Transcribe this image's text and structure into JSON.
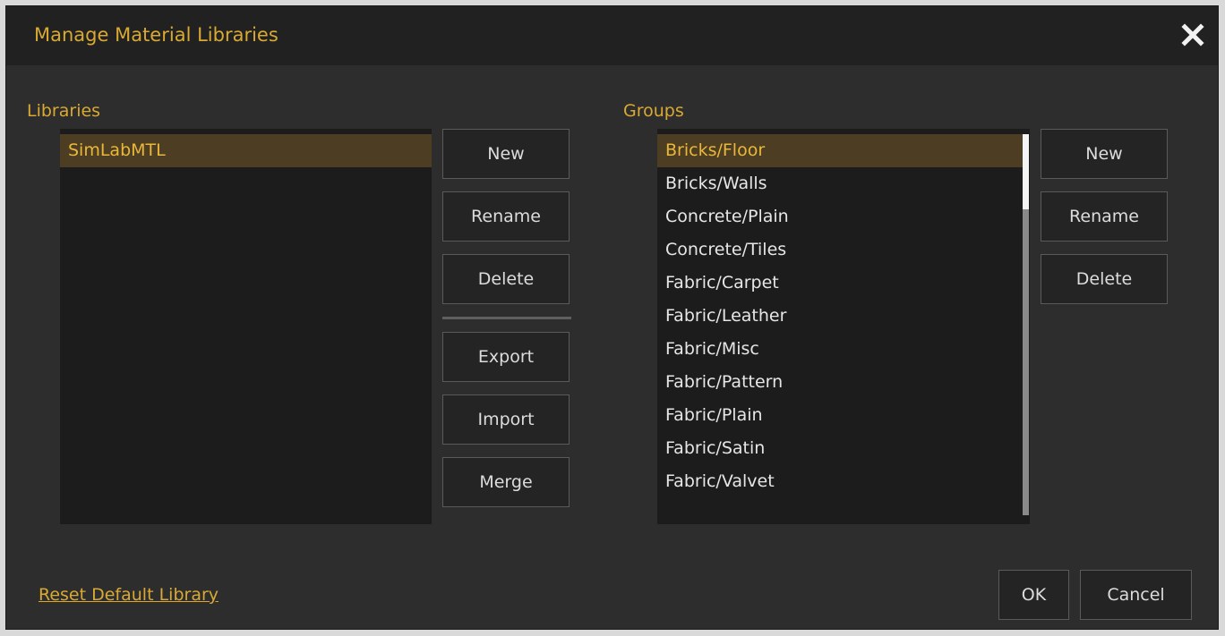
{
  "dialog": {
    "title": "Manage Material Libraries",
    "close_icon": "close-icon"
  },
  "libraries": {
    "label": "Libraries",
    "items": [
      "SimLabMTL"
    ],
    "selected_index": 0,
    "buttons": {
      "new": "New",
      "rename": "Rename",
      "delete": "Delete",
      "export": "Export",
      "import": "Import",
      "merge": "Merge"
    }
  },
  "groups": {
    "label": "Groups",
    "items": [
      "Bricks/Floor",
      "Bricks/Walls",
      "Concrete/Plain",
      "Concrete/Tiles",
      "Fabric/Carpet",
      "Fabric/Leather",
      "Fabric/Misc",
      "Fabric/Pattern",
      "Fabric/Plain",
      "Fabric/Satin",
      "Fabric/Valvet"
    ],
    "selected_index": 0,
    "buttons": {
      "new": "New",
      "rename": "Rename",
      "delete": "Delete"
    }
  },
  "footer": {
    "reset_link": "Reset Default Library",
    "ok": "OK",
    "cancel": "Cancel"
  },
  "colors": {
    "accent": "#d9a933",
    "selected_bg": "#4d3d22",
    "panel_bg": "#2d2d2d",
    "list_bg": "#1c1c1c"
  }
}
